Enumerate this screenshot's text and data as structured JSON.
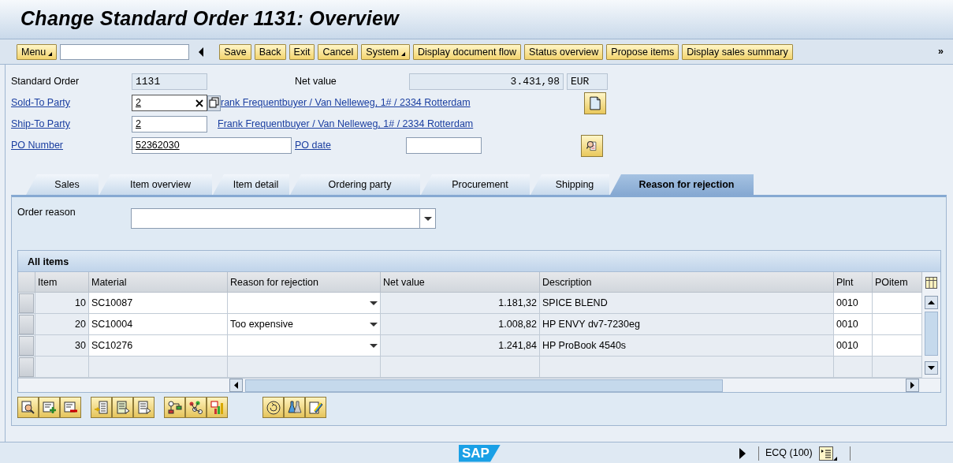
{
  "title": "Change Standard Order 1131: Overview",
  "toolbar": {
    "menu": {
      "label": "Menu",
      "has_menu": true
    },
    "buttons": [
      {
        "label": "Save",
        "has_menu": false
      },
      {
        "label": "Back",
        "has_menu": false
      },
      {
        "label": "Exit",
        "has_menu": false
      },
      {
        "label": "Cancel",
        "has_menu": false
      },
      {
        "label": "System",
        "has_menu": true
      },
      {
        "label": "Display document flow",
        "has_menu": false
      },
      {
        "label": "Status overview",
        "has_menu": false
      },
      {
        "label": "Propose items",
        "has_menu": false
      },
      {
        "label": "Display sales summary",
        "has_menu": false
      }
    ],
    "more": "»"
  },
  "header": {
    "standard_order": {
      "label": "Standard Order",
      "value": "1131"
    },
    "net_value": {
      "label": "Net value",
      "amount": "3.431,98",
      "currency": "EUR"
    },
    "sold_to": {
      "label": "Sold-To Party",
      "value": "2",
      "description": "rank Frequentbuyer / Van Nelleweg, 1# / 2334 Rotterdam",
      "focused": true
    },
    "ship_to": {
      "label": "Ship-To Party",
      "value": "2",
      "description": "Frank Frequentbuyer / Van Nelleweg, 1# / 2334 Rotterdam",
      "focused": false
    },
    "po_number": {
      "label": "PO Number",
      "value": "52362030"
    },
    "po_date": {
      "label": "PO date"
    }
  },
  "tabs": [
    {
      "label": "Sales",
      "selected": false
    },
    {
      "label": "Item overview",
      "selected": false
    },
    {
      "label": "Item detail",
      "selected": false
    },
    {
      "label": "Ordering party",
      "selected": false
    },
    {
      "label": "Procurement",
      "selected": false
    },
    {
      "label": "Shipping",
      "selected": false
    },
    {
      "label": "Reason for rejection",
      "selected": true
    }
  ],
  "order_reason": {
    "label": "Order reason"
  },
  "table": {
    "title": "All items",
    "columns": [
      {
        "label": "Item",
        "kind": "number"
      },
      {
        "label": "Material",
        "kind": "input"
      },
      {
        "label": "Reason for rejection",
        "kind": "dropdown"
      },
      {
        "label": "Net value",
        "kind": "number"
      },
      {
        "label": "Description",
        "kind": "text"
      },
      {
        "label": "Plnt",
        "kind": "input"
      },
      {
        "label": "POitem",
        "kind": "input"
      }
    ],
    "rows": [
      {
        "item": "10",
        "material": "SC10087",
        "net_value": "1.181,32",
        "description": "SPICE BLEND",
        "plant": "0010"
      },
      {
        "item": "20",
        "material": "SC10004",
        "reason_for_rejection": "Too expensive",
        "net_value": "1.008,82",
        "description": "HP ENVY dv7-7230eg",
        "plant": "0010"
      },
      {
        "item": "30",
        "material": "SC10276",
        "net_value": "1.241,84",
        "description": "HP ProBook 4540s",
        "plant": "0010"
      }
    ]
  },
  "status_bar": {
    "logo": "SAP",
    "system": "ECQ (100)"
  }
}
